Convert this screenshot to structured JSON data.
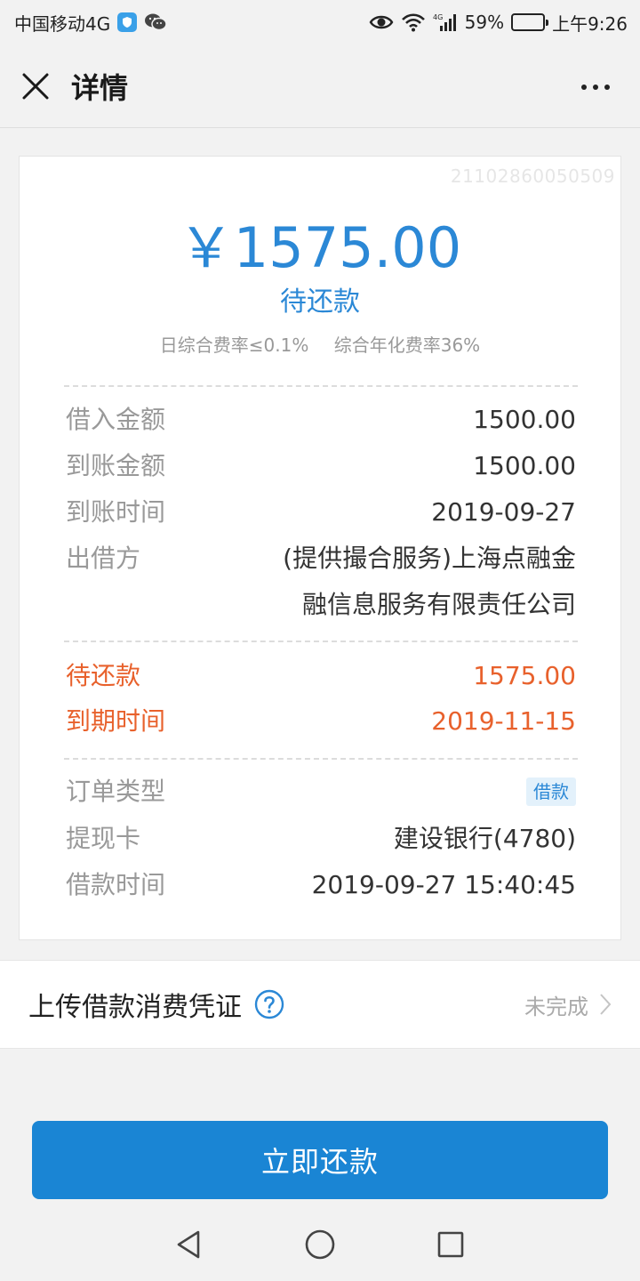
{
  "status_bar": {
    "carrier": "中国移动4G",
    "battery": "59%",
    "battery_level": 0.59,
    "time": "上午9:26"
  },
  "nav": {
    "title": "详情"
  },
  "card": {
    "order_no": "21102860050509",
    "amount": "￥1575.00",
    "status": "待还款",
    "daily_rate": "日综合费率≤0.1%",
    "annual_rate": "综合年化费率36%",
    "loan_amount_label": "借入金额",
    "loan_amount_value": "1500.00",
    "received_amount_label": "到账金额",
    "received_amount_value": "1500.00",
    "received_time_label": "到账时间",
    "received_time_value": "2019-09-27",
    "lender_label": "出借方",
    "lender_value_line1": "(提供撮合服务)上海点融金",
    "lender_value_line2": "融信息服务有限责任公司",
    "pending_label": "待还款",
    "pending_value": "1575.00",
    "due_label": "到期时间",
    "due_value": "2019-11-15",
    "order_type_label": "订单类型",
    "order_type_value": "借款",
    "card_label": "提现卡",
    "card_value": "建设银行(4780)",
    "loan_time_label": "借款时间",
    "loan_time_value": "2019-09-27 15:40:45"
  },
  "upload": {
    "label": "上传借款消费凭证",
    "status": "未完成"
  },
  "repay_button": {
    "label": "立即还款"
  },
  "colors": {
    "accent_blue": "#2b88d6",
    "button_blue": "#1a85d4",
    "alert_orange": "#e8612c"
  }
}
